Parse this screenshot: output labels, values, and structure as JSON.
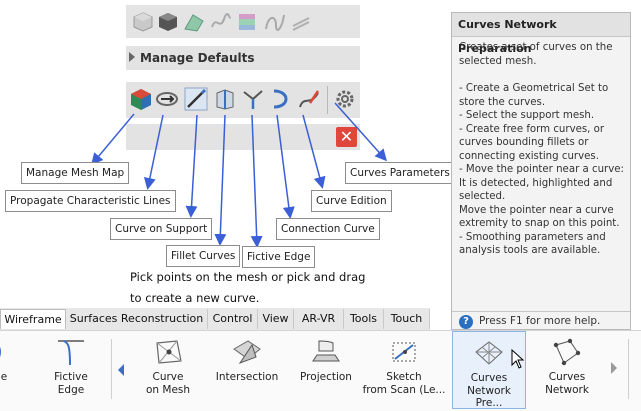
{
  "manage_defaults": "Manage Defaults",
  "callouts": {
    "manage_mesh_map": "Manage Mesh Map",
    "propagate_characteristic_lines": "Propagate Characteristic Lines",
    "curve_on_support": "Curve on Support",
    "fillet_curves": "Fillet Curves",
    "fictive_edge": "Fictive Edge",
    "connection_curve": "Connection Curve",
    "curve_edition": "Curve Edition",
    "curves_parameters": "Curves Parameters"
  },
  "instruction": {
    "line1": "Pick points on the mesh or pick and drag",
    "line2": "to create a new curve."
  },
  "help": {
    "title": "Curves Network Preparation",
    "intro": "Creates a set of curves on the selected mesh.",
    "bullets": "- Create a Geometrical Set to store the curves.\n- Select the support mesh.\n- Create free form curves, or curves bounding fillets or connecting existing curves.\n- Move the pointer near a curve: It is detected, highlighted and selected.\nMove the pointer near a curve extremity to snap on this point.\n- Smoothing parameters and analysis tools are available.",
    "footer": "Press F1 for more help."
  },
  "tabs": [
    "Wireframe",
    "Surfaces Reconstruction",
    "Control",
    "View",
    "AR-VR",
    "Tools",
    "Touch"
  ],
  "active_tab": "Wireframe",
  "ribbon": {
    "partial_label": "e",
    "fictive_edge": [
      "Fictive",
      "Edge"
    ],
    "curve_on_mesh": [
      "Curve",
      "on Mesh"
    ],
    "intersection": "Intersection",
    "projection": "Projection",
    "sketch_from_scan": [
      "Sketch",
      "from Scan (Le..."
    ],
    "curves_network_pre": [
      "Curves",
      "Network Pre..."
    ],
    "curves_network": [
      "Curves",
      "Network"
    ]
  },
  "colors": {
    "callout_line": "#3a5fd6",
    "close_button": "#e0463b",
    "selected_command": "#e8f1fb"
  }
}
